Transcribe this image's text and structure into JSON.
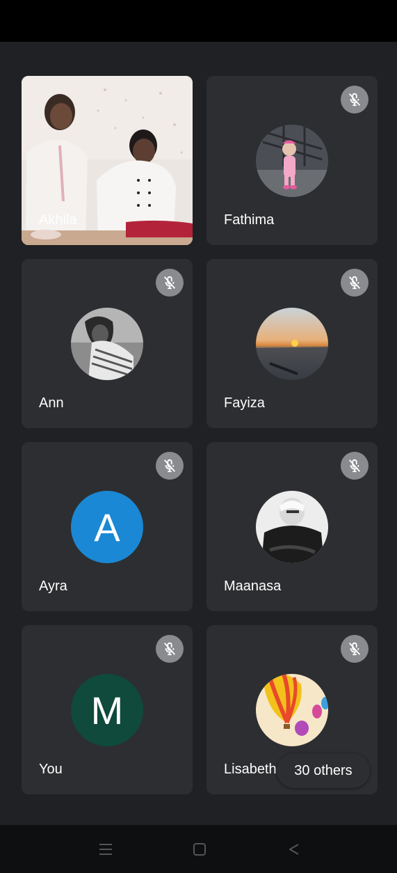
{
  "participants": [
    {
      "name": "Akhila",
      "type": "video"
    },
    {
      "name": "Fathima",
      "type": "photo",
      "muted": true
    },
    {
      "name": "Ann",
      "type": "photo",
      "muted": true
    },
    {
      "name": "Fayiza",
      "type": "photo",
      "muted": true
    },
    {
      "name": "Ayra",
      "type": "letter",
      "letter": "A",
      "color": "#1a88d4",
      "muted": true
    },
    {
      "name": "Maanasa",
      "type": "photo",
      "muted": true
    },
    {
      "name": "You",
      "type": "letter",
      "letter": "M",
      "color": "#0f4a3c",
      "muted": true
    },
    {
      "name": "Lisabeth",
      "type": "photo",
      "muted": true
    }
  ],
  "others_label": "30 others",
  "icons": {
    "mute": "mic-off-icon",
    "nav_menu": "recent-apps-icon",
    "nav_home": "home-icon",
    "nav_back": "back-icon"
  },
  "colors": {
    "tile_bg": "#2d2e31",
    "page_bg": "#202124",
    "mute_bg": "#8a8b8f"
  }
}
